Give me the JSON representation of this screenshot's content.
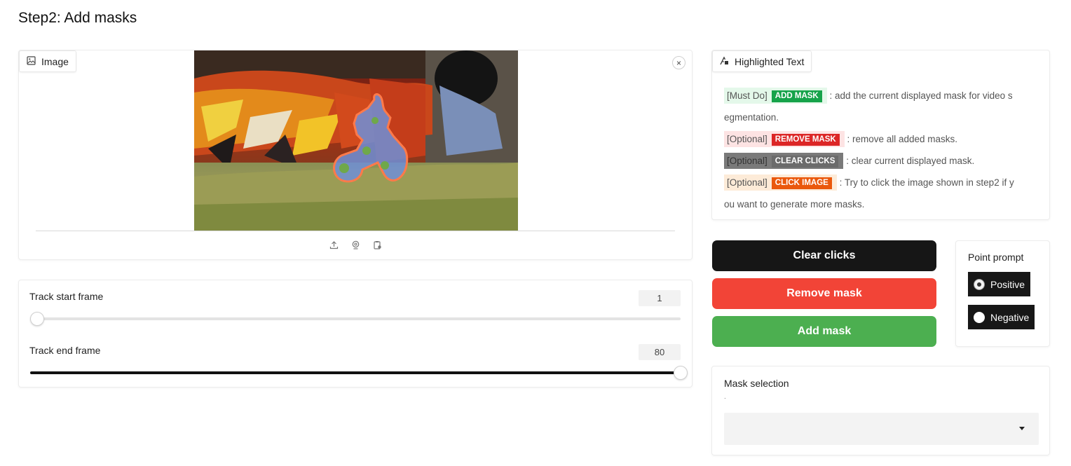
{
  "page": {
    "heading": "Step2: Add masks"
  },
  "image_panel": {
    "label": "Image",
    "close_glyph": "×",
    "image_icon": "image-icon",
    "tools": [
      "upload-icon",
      "webcam-icon",
      "clipboard-icon"
    ]
  },
  "sliders": [
    {
      "label": "Track start frame",
      "value": "1",
      "fraction": 0
    },
    {
      "label": "Track end frame",
      "value": "80",
      "fraction": 1
    }
  ],
  "highlighted_text": {
    "label": "Highlighted Text",
    "icon": "highlight-icon",
    "items": [
      {
        "prefix": "[Must Do]",
        "tag": "ADD MASK",
        "text": ": add the current displayed mask for video s",
        "text2": "egmentation.",
        "bg": "#e4f8ea",
        "tag_color": "#16a34a"
      },
      {
        "prefix": "[Optional]",
        "tag": "REMOVE MASK",
        "text": ": remove all added masks.",
        "bg": "#fde3e3",
        "tag_color": "#dc2626"
      },
      {
        "prefix": "[Optional]",
        "tag": "CLEAR CLICKS",
        "text": ": clear current displayed mask.",
        "bg": "#7a7a7a",
        "tag_color": "#6b6b6b",
        "prefix_color": "#ffffff"
      },
      {
        "prefix": "[Optional]",
        "tag": "CLICK IMAGE",
        "text": ": Try to click the image shown in step2 if y",
        "text2": "ou want to generate more masks.",
        "bg": "#fdebd8",
        "tag_color": "#ea580c"
      }
    ]
  },
  "buttons": {
    "clear": "Clear clicks",
    "remove": "Remove mask",
    "add": "Add mask"
  },
  "point_prompt": {
    "title": "Point prompt",
    "options": [
      "Positive",
      "Negative"
    ],
    "selected": "Positive"
  },
  "mask_selection": {
    "title": "Mask selection",
    "subtitle": ".",
    "value": ""
  },
  "colors": {
    "clear": "#161616",
    "remove": "#f24437",
    "add": "#4caf50"
  }
}
